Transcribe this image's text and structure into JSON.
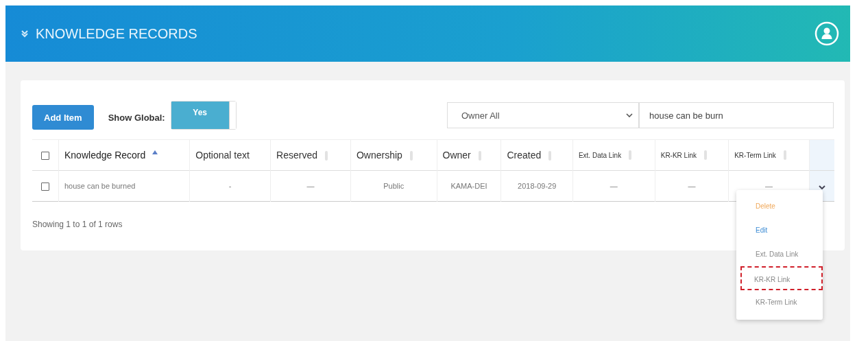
{
  "header": {
    "title": "KNOWLEDGE RECORDS",
    "expanded": true
  },
  "toolbar": {
    "add_button": "Add Item",
    "show_global": {
      "label": "Show Global:",
      "on": true,
      "on_text": "Yes"
    },
    "owner_select": {
      "value": "Owner All"
    },
    "search": {
      "value": "house can be burn"
    }
  },
  "table": {
    "select_all": {
      "checked": false
    },
    "columns": [
      {
        "label": "Knowledge Record",
        "sortable": true,
        "sorted": true,
        "compact": false
      },
      {
        "label": "Optional text",
        "sortable": false,
        "sorted": false,
        "compact": false
      },
      {
        "label": "Reserved",
        "sortable": true,
        "sorted": false,
        "compact": false
      },
      {
        "label": "Ownership",
        "sortable": true,
        "sorted": false,
        "compact": false
      },
      {
        "label": "Owner",
        "sortable": true,
        "sorted": false,
        "compact": false
      },
      {
        "label": "Created",
        "sortable": true,
        "sorted": false,
        "compact": false
      },
      {
        "label": "Ext. Data Link",
        "sortable": true,
        "sorted": false,
        "compact": true
      },
      {
        "label": "KR-KR Link",
        "sortable": true,
        "sorted": false,
        "compact": true
      },
      {
        "label": "KR-Term Link",
        "sortable": true,
        "sorted": false,
        "compact": true
      }
    ],
    "rows": [
      {
        "checked": false,
        "cells": [
          "house can be burned",
          "-",
          "—",
          "Public",
          "KAMA-DEI",
          "2018-09-29",
          "—",
          "—",
          "—"
        ],
        "menu_open": true
      }
    ]
  },
  "footer": {
    "summary": "Showing 1 to 1 of 1 rows"
  },
  "row_menu": {
    "items": [
      {
        "label": "Delete",
        "kind": "danger",
        "highlighted": false
      },
      {
        "label": "Edit",
        "kind": "primary",
        "highlighted": false
      },
      {
        "label": "Ext. Data Link",
        "kind": "plain",
        "highlighted": false
      },
      {
        "label": "KR-KR Link",
        "kind": "plain",
        "highlighted": true
      },
      {
        "label": "KR-Term Link",
        "kind": "plain",
        "highlighted": false
      }
    ]
  }
}
